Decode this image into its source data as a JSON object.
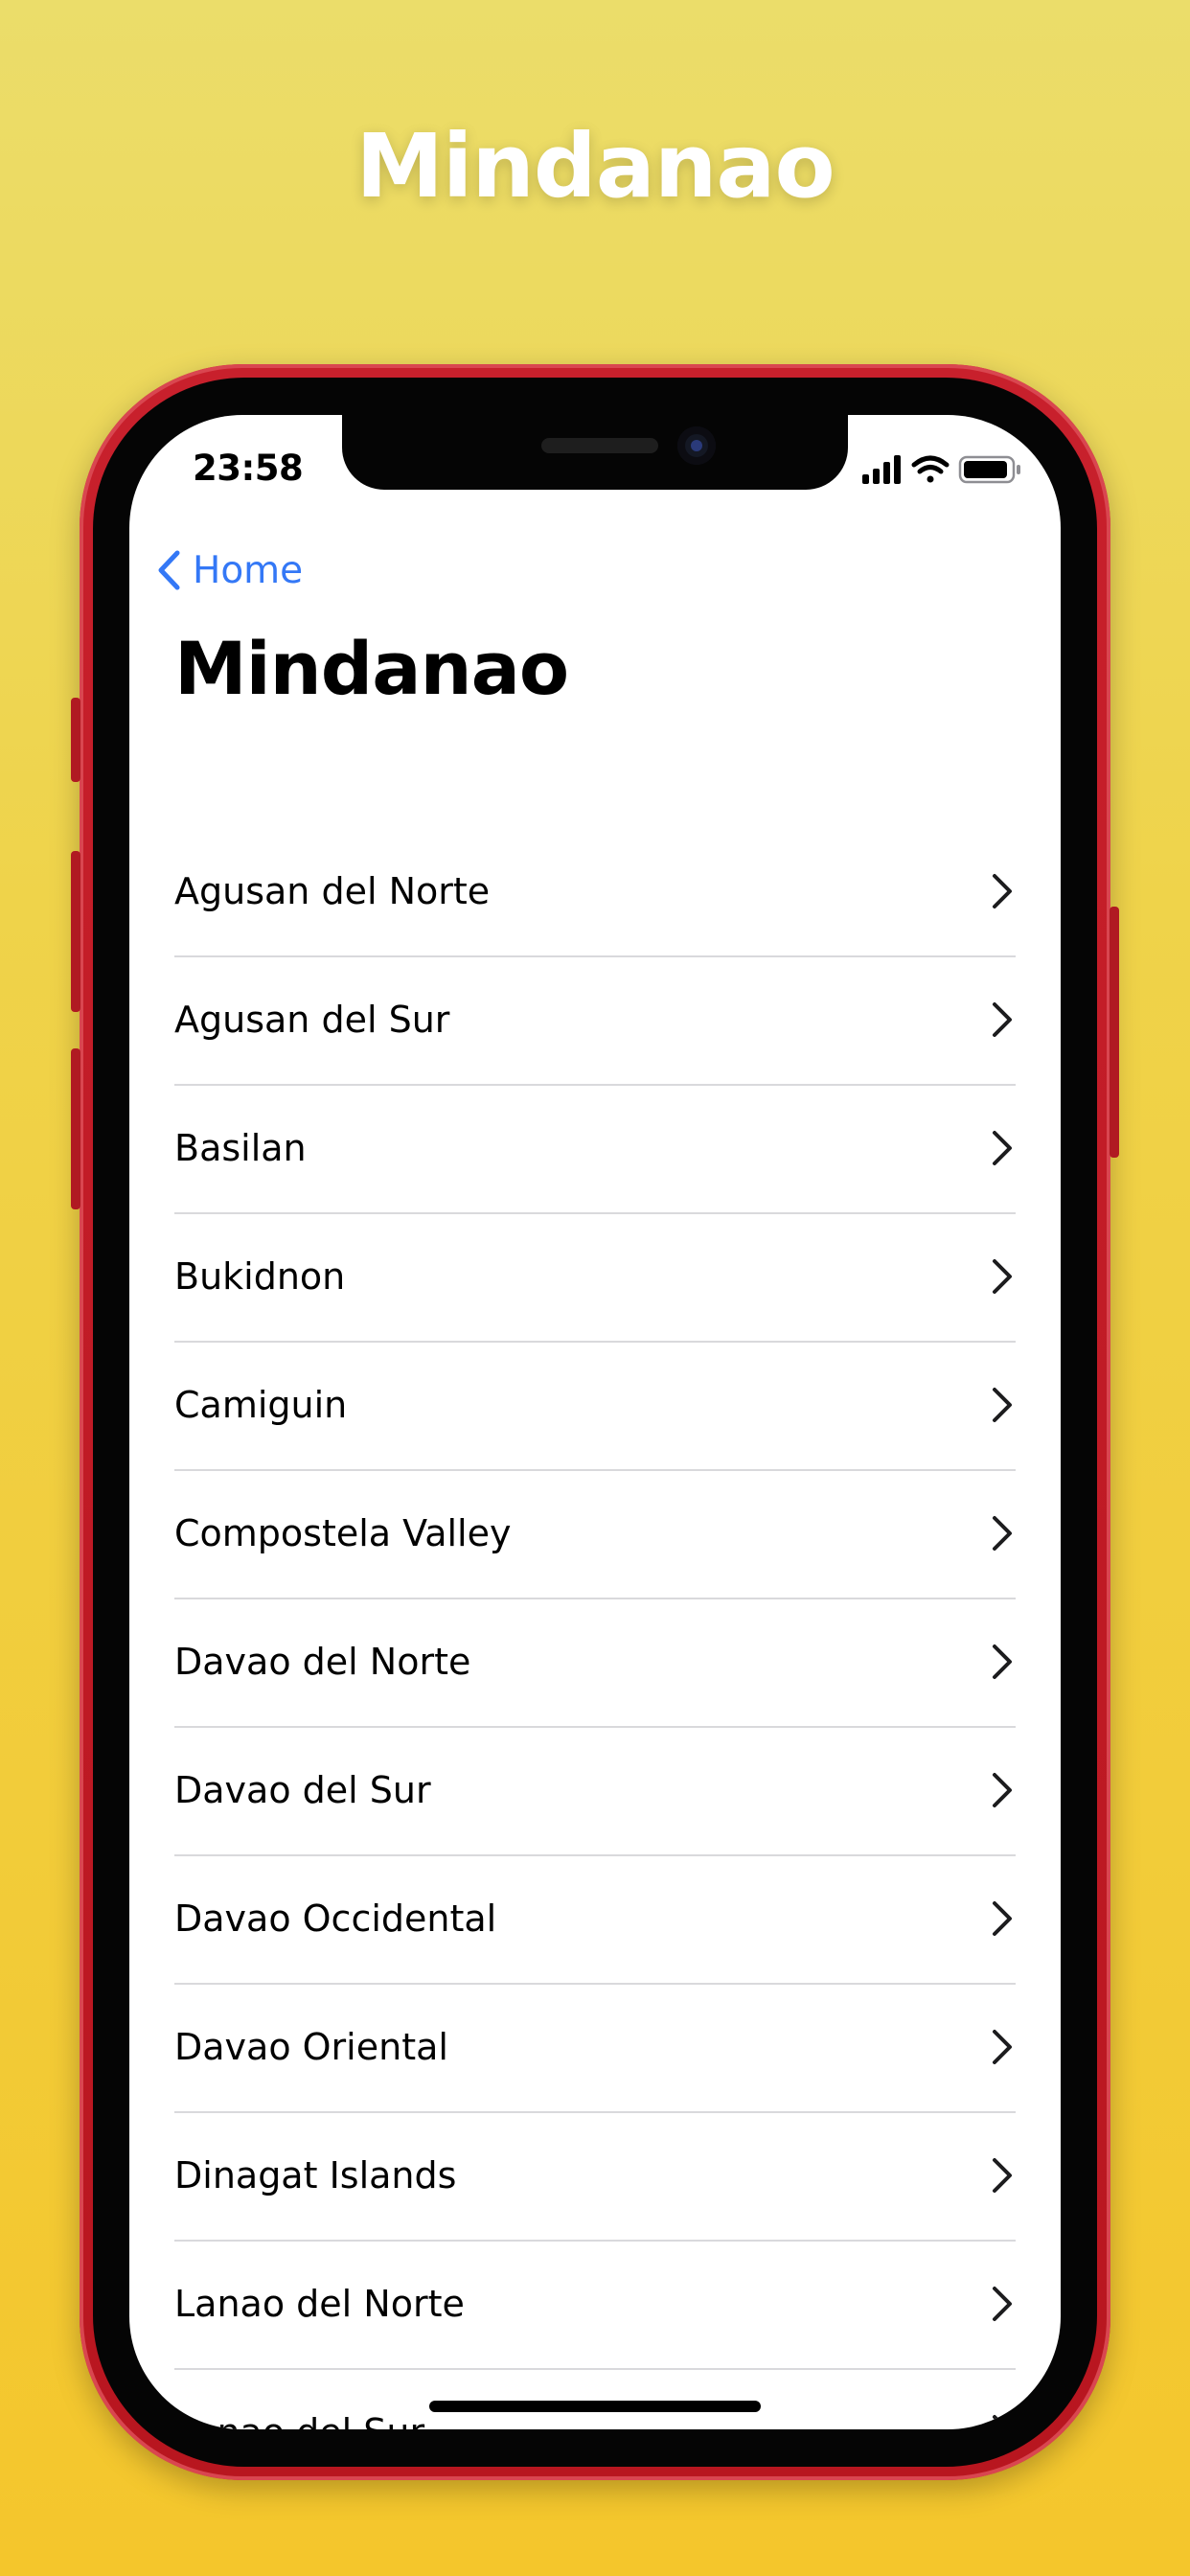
{
  "banner": {
    "title": "Mindanao"
  },
  "status_bar": {
    "time": "23:58"
  },
  "nav": {
    "back_label": "Home",
    "title": "Mindanao"
  },
  "provinces": [
    {
      "label": "Agusan del Norte"
    },
    {
      "label": "Agusan del Sur"
    },
    {
      "label": "Basilan"
    },
    {
      "label": "Bukidnon"
    },
    {
      "label": "Camiguin"
    },
    {
      "label": "Compostela Valley"
    },
    {
      "label": "Davao del Norte"
    },
    {
      "label": "Davao del Sur"
    },
    {
      "label": "Davao Occidental"
    },
    {
      "label": "Davao Oriental"
    },
    {
      "label": "Dinagat Islands"
    },
    {
      "label": "Lanao del Norte"
    },
    {
      "label": "Lanao del Sur"
    }
  ],
  "colors": {
    "accent": "#3478f6",
    "phone_frame": "#c8202c",
    "background_top": "#ebdd6a",
    "background_bottom": "#f4c62c"
  },
  "icons": {
    "back": "chevron-left-icon",
    "row": "chevron-right-icon",
    "signal": "cellular-signal-icon",
    "wifi": "wifi-icon",
    "battery": "battery-icon"
  }
}
